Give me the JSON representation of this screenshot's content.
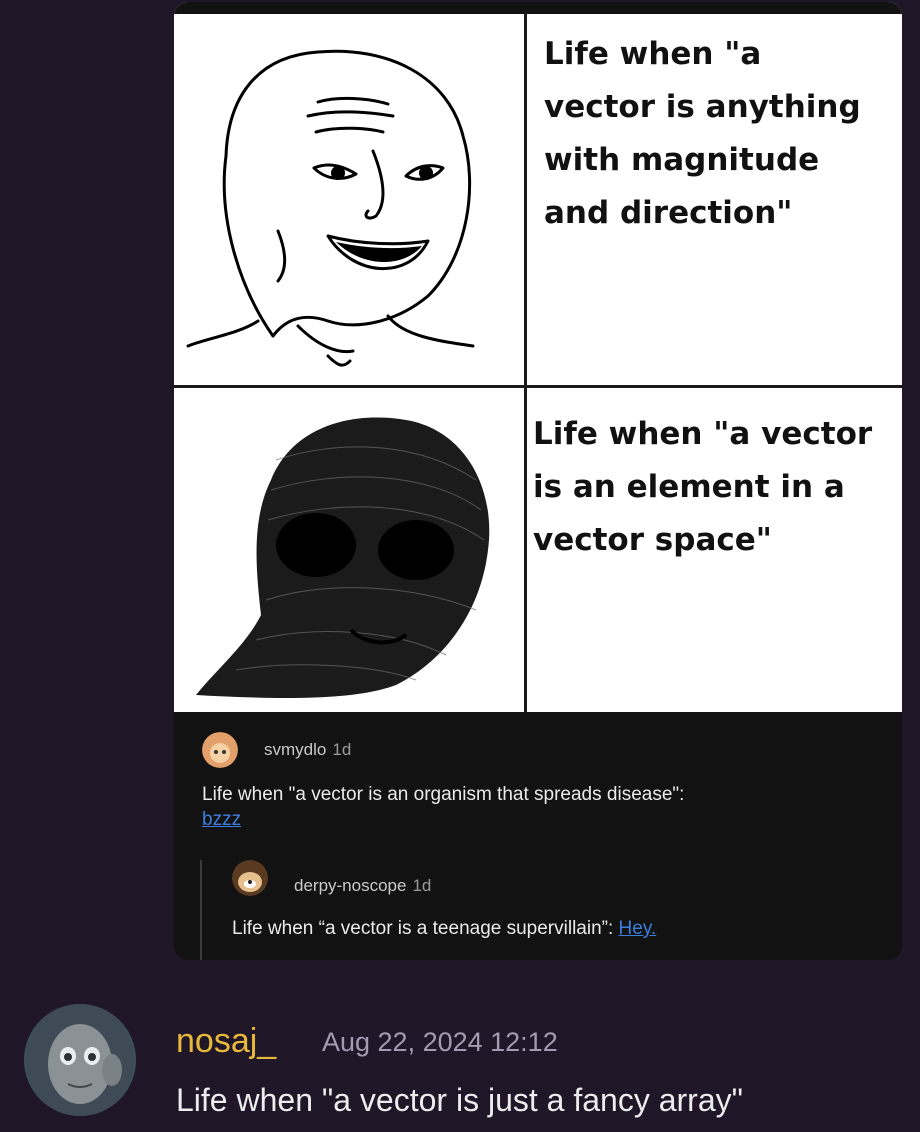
{
  "meme": {
    "caption_top": "Life when \"a\nvector is anything\nwith magnitude\nand direction\"",
    "caption_bottom": "Life when \"a vector\nis an element in a\nvector space\""
  },
  "comments": [
    {
      "user": "svmydlo",
      "age": "1d",
      "text": "Life when \"a vector is an organism that spreads disease\":",
      "link": "bzzz"
    },
    {
      "user": "derpy-noscope",
      "age": "1d",
      "text": "Life when “a vector is a teenage supervillain”:",
      "link": "Hey."
    }
  ],
  "message": {
    "username": "nosaj_",
    "timestamp": "Aug 22, 2024 12:12",
    "text": "Life when \"a vector is just a fancy array\"",
    "username_color": "#e8b83a"
  },
  "icons": {
    "avatar_1": "cartoon-avatar-icon",
    "avatar_2": "dog-avatar-icon",
    "message_avatar": "user-avatar"
  },
  "colors": {
    "background": "#1f1628",
    "link": "#3d7fe0"
  }
}
